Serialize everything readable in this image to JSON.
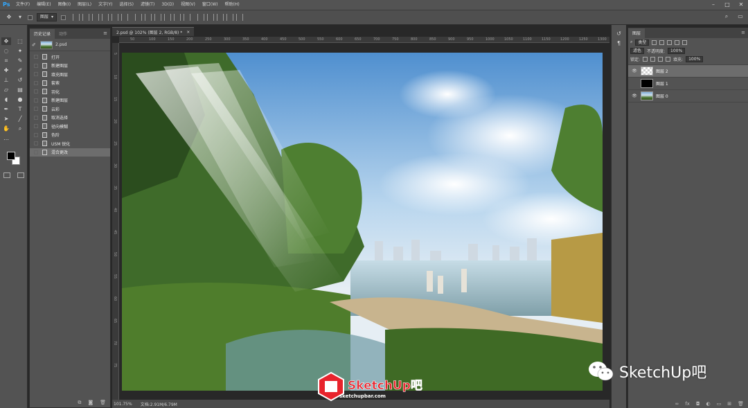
{
  "app": {
    "logo": "Ps",
    "menus": [
      "文件(F)",
      "编辑(E)",
      "图像(I)",
      "图层(L)",
      "文字(Y)",
      "选择(S)",
      "滤镜(T)",
      "3D(D)",
      "视图(V)",
      "窗口(W)",
      "帮助(H)"
    ]
  },
  "options_bar": {
    "auto_select_value": "图层"
  },
  "history_panel": {
    "tabs": [
      "历史记录",
      "动作"
    ],
    "snapshot_label": "2.psd",
    "items": [
      "打开",
      "新建图层",
      "填充图层",
      "套索",
      "羽化",
      "新建图层",
      "云彩",
      "取消选择",
      "径向模糊",
      "色阶",
      "USM 锐化",
      "混合更改"
    ],
    "selected_index": 11
  },
  "document": {
    "tab_title": "2.psd @ 102% (图层 2, RGB/8) *",
    "ruler_marks": [
      "50",
      "100",
      "150",
      "200",
      "250",
      "300",
      "350",
      "400",
      "450",
      "500",
      "550",
      "600",
      "650",
      "700",
      "750",
      "800",
      "850",
      "900",
      "950",
      "1000",
      "1050",
      "1100",
      "1150",
      "1200",
      "1250",
      "1300"
    ],
    "ruler_v_marks": [
      "5",
      "10",
      "15",
      "20",
      "25",
      "30",
      "35",
      "40",
      "45",
      "50",
      "55",
      "60",
      "65",
      "70",
      "75"
    ],
    "zoom": "101.75%",
    "doc_info": "文档:2.91M/6.79M"
  },
  "layers_panel": {
    "tab": "图层",
    "filter_kind": "类型",
    "blend_mode": "滤色",
    "opacity_label": "不透明度:",
    "opacity_value": "100%",
    "lock_label": "锁定:",
    "fill_label": "填充:",
    "fill_value": "100%",
    "layers": [
      {
        "name": "图层 2",
        "visible": true,
        "selected": true
      },
      {
        "name": "图层 1",
        "visible": false,
        "selected": false
      },
      {
        "name": "图层 0",
        "visible": true,
        "selected": false
      }
    ]
  },
  "watermark": {
    "brand": "SketchUp吧",
    "logo_text": "SketchUp吧",
    "logo_url": "sketchupbar.com"
  },
  "colors": {
    "menubar": "#535353",
    "panel": "#535353",
    "workspace": "#282828",
    "accent_ps": "#31a8ff",
    "logo_red": "#e8232c"
  }
}
